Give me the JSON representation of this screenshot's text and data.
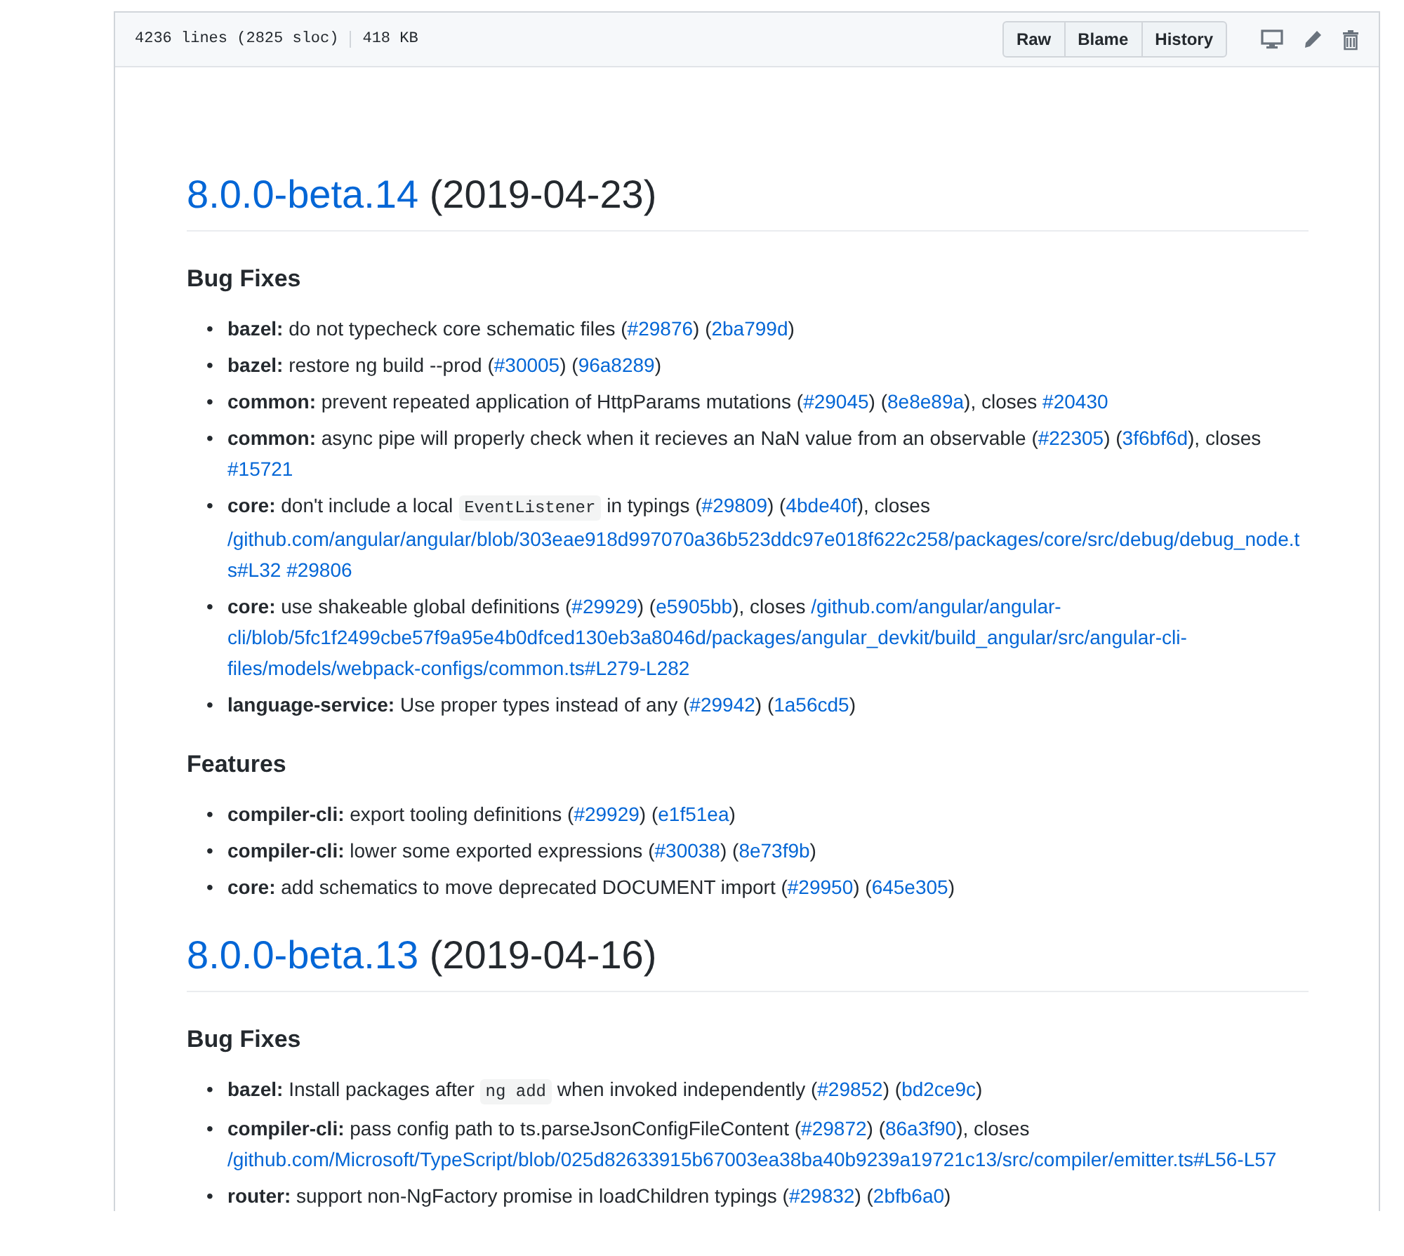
{
  "bullet": "•",
  "file_header": {
    "lines": "4236 lines (2825 sloc)",
    "size": "418 KB",
    "buttons": [
      "Raw",
      "Blame",
      "History"
    ]
  },
  "releases": [
    {
      "version": "8.0.0-beta.14",
      "date": "(2019-04-23)",
      "sections": [
        {
          "heading": "Bug Fixes",
          "items": [
            [
              {
                "kind": "scope",
                "text": "bazel:"
              },
              {
                "kind": "text",
                "text": " do not typecheck core schematic files ("
              },
              {
                "kind": "link",
                "text": "#29876"
              },
              {
                "kind": "text",
                "text": ") ("
              },
              {
                "kind": "link",
                "text": "2ba799d"
              },
              {
                "kind": "text",
                "text": ")"
              }
            ],
            [
              {
                "kind": "scope",
                "text": "bazel:"
              },
              {
                "kind": "text",
                "text": " restore ng build --prod ("
              },
              {
                "kind": "link",
                "text": "#30005"
              },
              {
                "kind": "text",
                "text": ") ("
              },
              {
                "kind": "link",
                "text": "96a8289"
              },
              {
                "kind": "text",
                "text": ")"
              }
            ],
            [
              {
                "kind": "scope",
                "text": "common:"
              },
              {
                "kind": "text",
                "text": " prevent repeated application of HttpParams mutations ("
              },
              {
                "kind": "link",
                "text": "#29045"
              },
              {
                "kind": "text",
                "text": ") ("
              },
              {
                "kind": "link",
                "text": "8e8e89a"
              },
              {
                "kind": "text",
                "text": "), closes "
              },
              {
                "kind": "link",
                "text": "#20430"
              }
            ],
            [
              {
                "kind": "scope",
                "text": "common:"
              },
              {
                "kind": "text",
                "text": " async pipe will properly check when it recieves an NaN value from an observable ("
              },
              {
                "kind": "link",
                "text": "#22305"
              },
              {
                "kind": "text",
                "text": ") ("
              },
              {
                "kind": "link",
                "text": "3f6bf6d"
              },
              {
                "kind": "text",
                "text": "), closes "
              },
              {
                "kind": "link",
                "text": "#15721"
              }
            ],
            [
              {
                "kind": "scope",
                "text": "core:"
              },
              {
                "kind": "text",
                "text": " don't include a local "
              },
              {
                "kind": "code",
                "text": "EventListener"
              },
              {
                "kind": "text",
                "text": " in typings ("
              },
              {
                "kind": "link",
                "text": "#29809"
              },
              {
                "kind": "text",
                "text": ") ("
              },
              {
                "kind": "link",
                "text": "4bde40f"
              },
              {
                "kind": "text",
                "text": "), closes "
              },
              {
                "kind": "longlink",
                "text": "/github.com/angular/angular/blob/303eae918d997070a36b523ddc97e018f622c258/packages/core/src/debug/debug_node.ts#L32"
              },
              {
                "kind": "link",
                "text": "#29806",
                "gap": true
              }
            ],
            [
              {
                "kind": "scope",
                "text": "core:"
              },
              {
                "kind": "text",
                "text": " use shakeable global definitions ("
              },
              {
                "kind": "link",
                "text": "#29929"
              },
              {
                "kind": "text",
                "text": ") ("
              },
              {
                "kind": "link",
                "text": "e5905bb"
              },
              {
                "kind": "text",
                "text": "), closes "
              },
              {
                "kind": "longlink",
                "text": "/github.com/angular/angular-cli/blob/5fc1f2499cbe57f9a95e4b0dfced130eb3a8046d/packages/angular_devkit/build_angular/src/angular-cli-files/models/webpack-configs/common.ts#L279-L282"
              }
            ],
            [
              {
                "kind": "scope",
                "text": "language-service:"
              },
              {
                "kind": "text",
                "text": " Use proper types instead of any ("
              },
              {
                "kind": "link",
                "text": "#29942"
              },
              {
                "kind": "text",
                "text": ") ("
              },
              {
                "kind": "link",
                "text": "1a56cd5"
              },
              {
                "kind": "text",
                "text": ")"
              }
            ]
          ]
        },
        {
          "heading": "Features",
          "items": [
            [
              {
                "kind": "scope",
                "text": "compiler-cli:"
              },
              {
                "kind": "text",
                "text": " export tooling definitions ("
              },
              {
                "kind": "link",
                "text": "#29929"
              },
              {
                "kind": "text",
                "text": ") ("
              },
              {
                "kind": "link",
                "text": "e1f51ea"
              },
              {
                "kind": "text",
                "text": ")"
              }
            ],
            [
              {
                "kind": "scope",
                "text": "compiler-cli:"
              },
              {
                "kind": "text",
                "text": " lower some exported expressions ("
              },
              {
                "kind": "link",
                "text": "#30038"
              },
              {
                "kind": "text",
                "text": ") ("
              },
              {
                "kind": "link",
                "text": "8e73f9b"
              },
              {
                "kind": "text",
                "text": ")"
              }
            ],
            [
              {
                "kind": "scope",
                "text": "core:"
              },
              {
                "kind": "text",
                "text": " add schematics to move deprecated DOCUMENT import ("
              },
              {
                "kind": "link",
                "text": "#29950"
              },
              {
                "kind": "text",
                "text": ") ("
              },
              {
                "kind": "link",
                "text": "645e305"
              },
              {
                "kind": "text",
                "text": ")"
              }
            ]
          ]
        }
      ]
    },
    {
      "version": "8.0.0-beta.13",
      "date": "(2019-04-16)",
      "sections": [
        {
          "heading": "Bug Fixes",
          "items": [
            [
              {
                "kind": "scope",
                "text": "bazel:"
              },
              {
                "kind": "text",
                "text": " Install packages after "
              },
              {
                "kind": "code",
                "text": "ng add"
              },
              {
                "kind": "text",
                "text": " when invoked independently ("
              },
              {
                "kind": "link",
                "text": "#29852"
              },
              {
                "kind": "text",
                "text": ") ("
              },
              {
                "kind": "link",
                "text": "bd2ce9c"
              },
              {
                "kind": "text",
                "text": ")"
              }
            ],
            [
              {
                "kind": "scope",
                "text": "compiler-cli:"
              },
              {
                "kind": "text",
                "text": " pass config path to ts.parseJsonConfigFileContent ("
              },
              {
                "kind": "link",
                "text": "#29872"
              },
              {
                "kind": "text",
                "text": ") ("
              },
              {
                "kind": "link",
                "text": "86a3f90"
              },
              {
                "kind": "text",
                "text": "), closes "
              },
              {
                "kind": "longlink",
                "text": "/github.com/Microsoft/TypeScript/blob/025d82633915b67003ea38ba40b9239a19721c13/src/compiler/emitter.ts#L56-L57"
              }
            ],
            [
              {
                "kind": "scope",
                "text": "router:"
              },
              {
                "kind": "text",
                "text": " support non-NgFactory promise in loadChildren typings ("
              },
              {
                "kind": "link",
                "text": "#29832"
              },
              {
                "kind": "text",
                "text": ") ("
              },
              {
                "kind": "link",
                "text": "2bfb6a0"
              },
              {
                "kind": "text",
                "text": ")"
              }
            ]
          ]
        }
      ]
    }
  ]
}
